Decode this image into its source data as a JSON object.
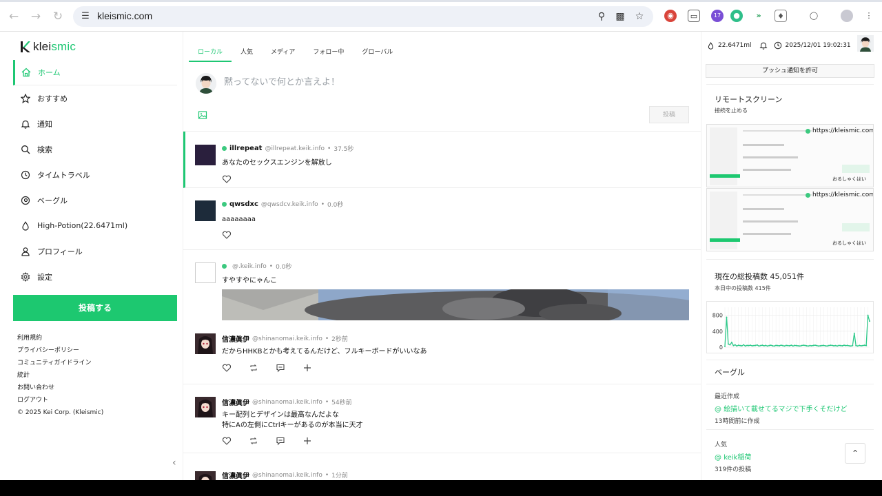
{
  "browser": {
    "url": "kleismic.com",
    "extension_badge": "17"
  },
  "app": {
    "logo_text_prefix": "klei",
    "logo_text_suffix": "smic",
    "brand_color": "#1ec773"
  },
  "sidebar": {
    "items": [
      {
        "label": "ホーム",
        "icon": "home-icon",
        "active": true
      },
      {
        "label": "おすすめ",
        "icon": "star-icon"
      },
      {
        "label": "通知",
        "icon": "bell-icon"
      },
      {
        "label": "検索",
        "icon": "search-icon"
      },
      {
        "label": "タイムトラベル",
        "icon": "clock-icon"
      },
      {
        "label": "ベーグル",
        "icon": "bagel-icon"
      },
      {
        "label": "High-Potion(22.6471ml)",
        "icon": "drop-icon"
      },
      {
        "label": "プロフィール",
        "icon": "user-icon"
      },
      {
        "label": "設定",
        "icon": "gear-icon"
      }
    ],
    "post_button": "投稿する",
    "footer": [
      "利用規約",
      "プライバシーポリシー",
      "コミュニティガイドライン",
      "統計",
      "お問い合わせ",
      "ログアウト",
      "© 2025 Kei Corp. (Kleismic)"
    ]
  },
  "timeline": {
    "tabs": [
      "ローカル",
      "人気",
      "メディア",
      "フォロー中",
      "グローバル"
    ],
    "compose_placeholder": "黙ってないで何とか言えよ！",
    "compose_submit": "投稿",
    "posts": [
      {
        "name": "illrepeat",
        "handle": "@illrepeat.keik.info",
        "time": "37.5秒",
        "text": "あなたのセックスエンジンを解放し",
        "online": true
      },
      {
        "name": "qwsdxc",
        "handle": "@qwsdcv.keik.info",
        "time": "0.0秒",
        "text": "aaaaaaaa",
        "online": true
      },
      {
        "name": "",
        "handle": "@.keik.info",
        "time": "0.0秒",
        "text": "すやすやにゃんこ",
        "online": true
      },
      {
        "name": "信濃眞伊",
        "handle": "@shinanomai.keik.info",
        "time": "2秒前",
        "text": "だからHHKBとかも考えてるんだけど、フルキーボードがいいなあ"
      },
      {
        "name": "信濃眞伊",
        "handle": "@shinanomai.keik.info",
        "time": "54秒前",
        "text_line1": "キー配列とデザインは最高なんだよな",
        "text_line2": "特にAの左側にCtrlキーがあるのが本当に天才"
      },
      {
        "name": "信濃眞伊",
        "handle": "@shinanomai.keik.info",
        "time": "1分前"
      }
    ],
    "separator": "•"
  },
  "right": {
    "potion": "22.6471ml",
    "datetime": "2025/12/01 19:02:31",
    "push_button": "プッシュ通知を許可",
    "remote_title": "リモートスクリーン",
    "remote_sub": "接続を止める",
    "remote_url": "https://kleismic.com/",
    "remote_user": "おるしゃくはい",
    "stats_title": "現在の総投稿数 45,051件",
    "stats_sub": "本日中の投稿数 415件",
    "bagel_title": "ベーグル",
    "recent_label": "最近作成",
    "recent_link": "絵描いて載せてるマジで下手くそだけど",
    "recent_time": "13時間前に作成",
    "popular_label": "人気",
    "popular_link": "keik稲荷",
    "popular_count": "319件の投稿"
  },
  "chart_data": {
    "type": "line",
    "title": "",
    "ylim": [
      0,
      1000
    ],
    "yticks": [
      "800",
      "400",
      "0"
    ],
    "series": [
      {
        "values": [
          20,
          750,
          80,
          60,
          120,
          40,
          60,
          30,
          50,
          40,
          35,
          60,
          30,
          45,
          40,
          50,
          35,
          40,
          45,
          55,
          30,
          40,
          50,
          35,
          45,
          30,
          40,
          50,
          35,
          30,
          45,
          40,
          35,
          50,
          40,
          30,
          45,
          40,
          35,
          50,
          30,
          45,
          40,
          35,
          30,
          40,
          50,
          45,
          35,
          30,
          40,
          35,
          45,
          50,
          40,
          30,
          35,
          40,
          45,
          35,
          30,
          40,
          50,
          45,
          35,
          40,
          30,
          45,
          40,
          35,
          50,
          40,
          45,
          35,
          30,
          40,
          350,
          40,
          30,
          45,
          35,
          40,
          50,
          40,
          800,
          650
        ]
      }
    ],
    "color": "#2ec98a"
  }
}
